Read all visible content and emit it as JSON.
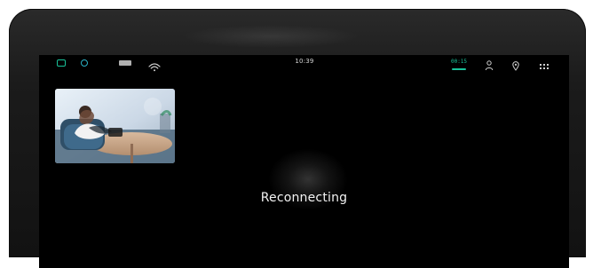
{
  "status_bar": {
    "clock_text": "10:39",
    "timer_text": "00:15",
    "icons": {
      "left": [
        "chat-icon",
        "globe-icon",
        "screen-icon",
        "wifi-icon"
      ],
      "right": [
        "user-icon",
        "pin-icon",
        "grid-icon"
      ]
    },
    "colors": {
      "accent": "#19c39a",
      "globe": "#2bb3c8"
    }
  },
  "main": {
    "status_text": "Reconnecting"
  },
  "thumbnail": {
    "alt": "Video thumbnail"
  }
}
